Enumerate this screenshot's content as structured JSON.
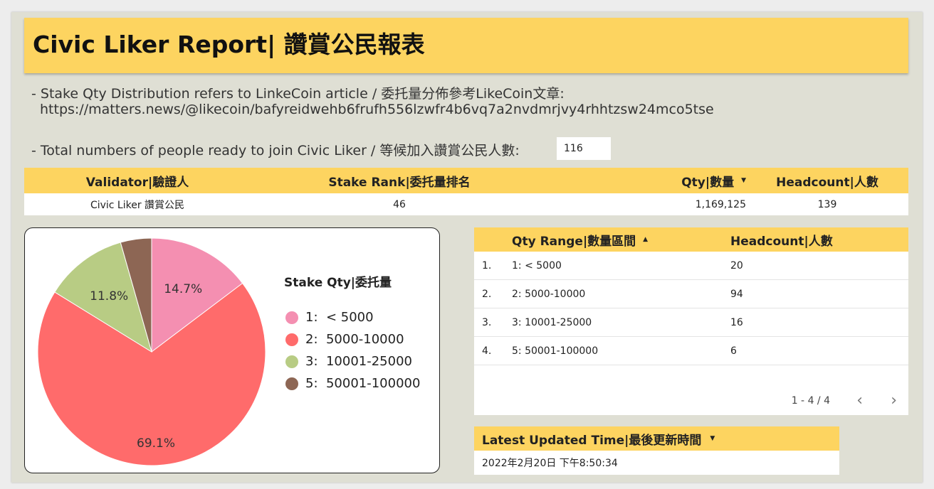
{
  "header": {
    "title": "Civic Liker Report| 讚賞公民報表"
  },
  "notes": {
    "line1": "- Stake Qty Distribution refers to LinkeCoin article / 委托量分佈參考LikeCoin文章:",
    "line1_url": "https://matters.news/@likecoin/bafyreidwehb6frufh556lzwfr4b6vq7a2nvdmrjvy4rhhtzsw24mco5tse",
    "line2": "- Total numbers of people ready to join Civic Liker / 等候加入讚賞公民人數:",
    "count": "116"
  },
  "validator_table": {
    "headers": [
      "Validator|驗證人",
      "Stake Rank|委托量排名",
      "Qty|數量",
      "Headcount|人數"
    ],
    "sort_caret": "▼",
    "row": [
      "Civic Liker 讚賞公民",
      "46",
      "1,169,125",
      "139"
    ]
  },
  "pie": {
    "legend_title": "Stake Qty|委托量",
    "slice_labels": [
      "14.7%",
      "69.1%",
      "11.8%"
    ]
  },
  "chart_data": {
    "type": "pie",
    "title": "Stake Qty|委托量",
    "categories": [
      "1:  < 5000",
      "2:  5000-10000",
      "3:  10001-25000",
      "5:  50001-100000"
    ],
    "values": [
      14.7,
      69.1,
      11.8,
      4.4
    ],
    "colors": [
      "#f48fb1",
      "#ff6b6b",
      "#b8cc84",
      "#8d6654"
    ],
    "legend_position": "right"
  },
  "range_table": {
    "headers": [
      "Qty Range|數量區間",
      "Headcount|人數"
    ],
    "sort_caret": "▲",
    "rows": [
      {
        "index": "1.",
        "range": "1:  < 5000",
        "count": "20"
      },
      {
        "index": "2.",
        "range": "2:  5000-10000",
        "count": "94"
      },
      {
        "index": "3.",
        "range": "3:  10001-25000",
        "count": "16"
      },
      {
        "index": "4.",
        "range": "5:  50001-100000",
        "count": "6"
      }
    ],
    "pager": "1 - 4 / 4",
    "prev_icon": "chevron-left-icon",
    "next_icon": "chevron-right-icon"
  },
  "updated": {
    "title": "Latest Updated Time|最後更新時間",
    "sort_caret": "▼",
    "value": "2022年2月20日 下午8:50:34"
  }
}
